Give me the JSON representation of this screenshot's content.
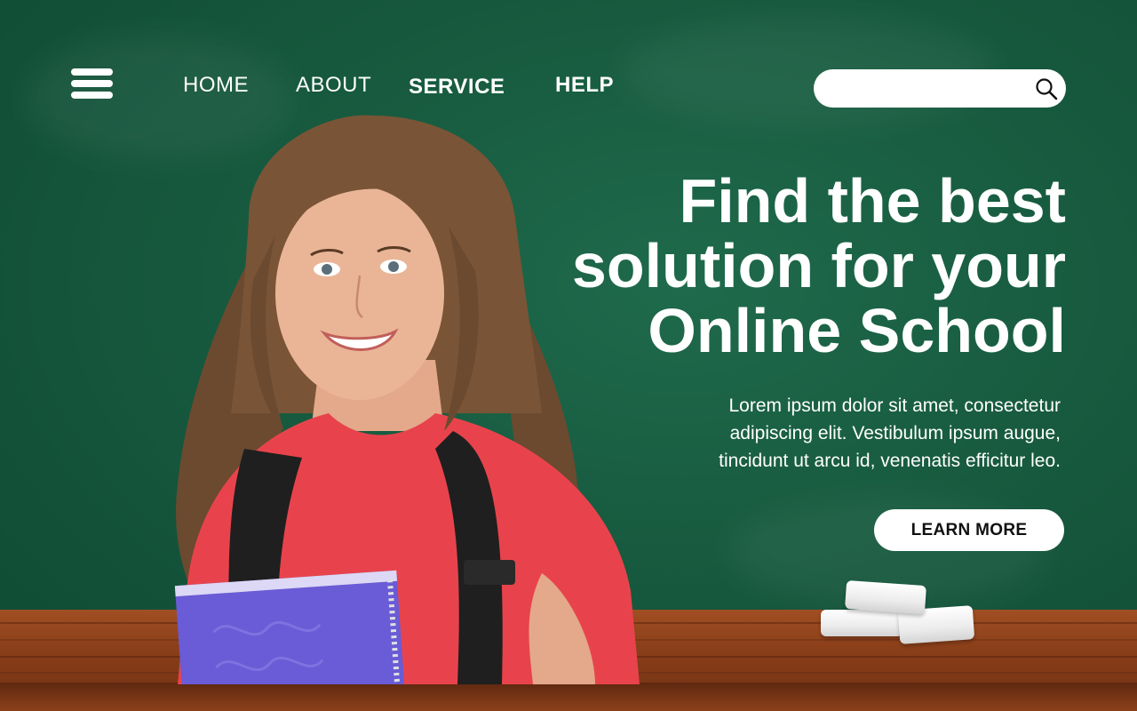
{
  "nav": {
    "menu_icon": "hamburger-menu-icon",
    "links": [
      {
        "label": "HOME"
      },
      {
        "label": "ABOUT"
      },
      {
        "label": "SERVICE"
      },
      {
        "label": "HELP"
      }
    ]
  },
  "search": {
    "placeholder": "",
    "icon": "search-icon"
  },
  "hero": {
    "title": "Find the best\nsolution for your\nOnline School",
    "body": "Lorem ipsum dolor sit amet, consectetur\nadipiscing elit. Vestibulum ipsum augue,\ntincidunt ut arcu id, venenatis efficitur leo.",
    "cta_label": "LEARN MORE"
  },
  "colors": {
    "chalkboard": "#175a3f",
    "desk": "#8a3f19",
    "text": "#ffffff",
    "button_bg": "#ffffff",
    "button_text": "#111111",
    "shirt": "#e8434c",
    "notebook": "#6a5bd6"
  }
}
